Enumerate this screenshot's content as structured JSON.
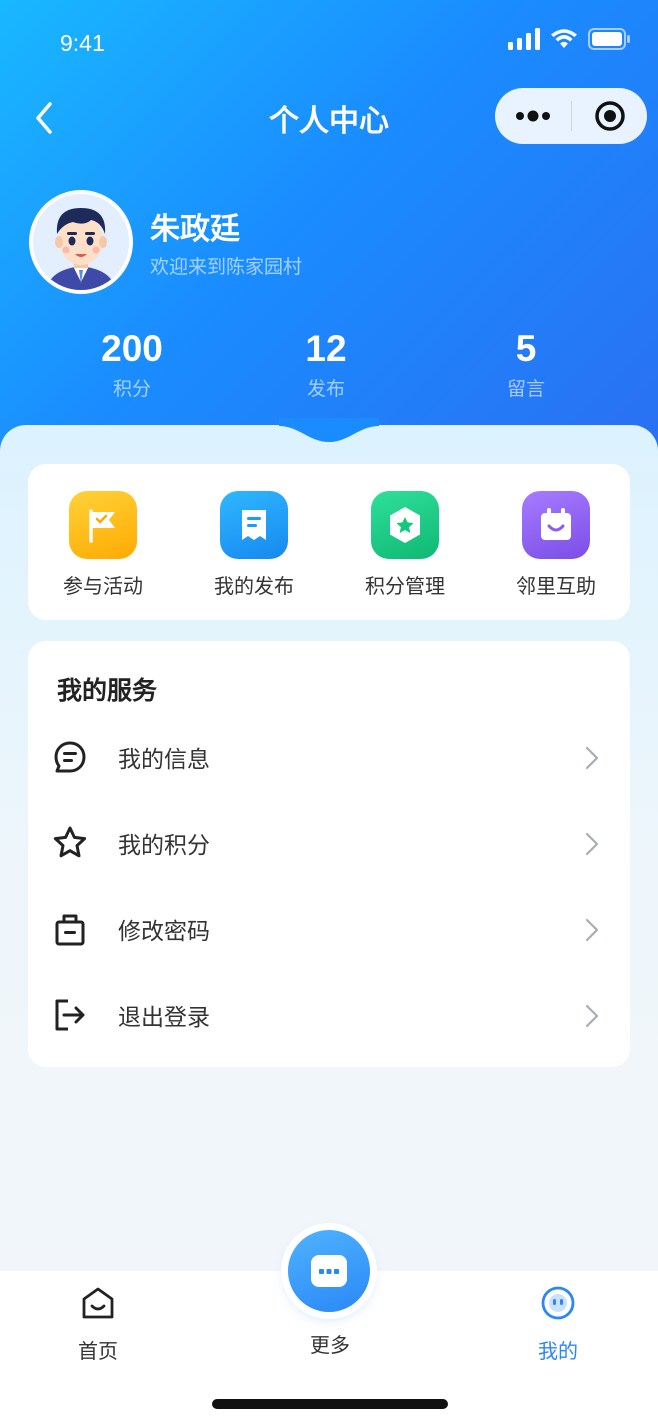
{
  "status_bar": {
    "time": "9:41"
  },
  "nav": {
    "title": "个人中心"
  },
  "profile": {
    "name": "朱政廷",
    "welcome": "欢迎来到陈家园村"
  },
  "stats": [
    {
      "value": "200",
      "label": "积分"
    },
    {
      "value": "12",
      "label": "发布"
    },
    {
      "value": "5",
      "label": "留言"
    }
  ],
  "quick_actions": [
    {
      "label": "参与活动",
      "icon": "flag-icon",
      "color": "#ffb300"
    },
    {
      "label": "我的发布",
      "icon": "document-icon",
      "color": "#1d9bf5"
    },
    {
      "label": "积分管理",
      "icon": "star-badge-icon",
      "color": "#12c77e"
    },
    {
      "label": "邻里互助",
      "icon": "calendar-smile-icon",
      "color": "#8a5cf0"
    }
  ],
  "services": {
    "title": "我的服务",
    "items": [
      {
        "label": "我的信息",
        "icon": "message-icon"
      },
      {
        "label": "我的积分",
        "icon": "star-icon"
      },
      {
        "label": "修改密码",
        "icon": "lock-icon"
      },
      {
        "label": "退出登录",
        "icon": "logout-icon"
      }
    ]
  },
  "tabbar": {
    "items": [
      {
        "label": "首页",
        "icon": "home-icon"
      },
      {
        "label": "更多",
        "icon": "more-icon"
      },
      {
        "label": "我的",
        "icon": "profile-icon"
      }
    ],
    "active_color": "#2a88f5"
  }
}
